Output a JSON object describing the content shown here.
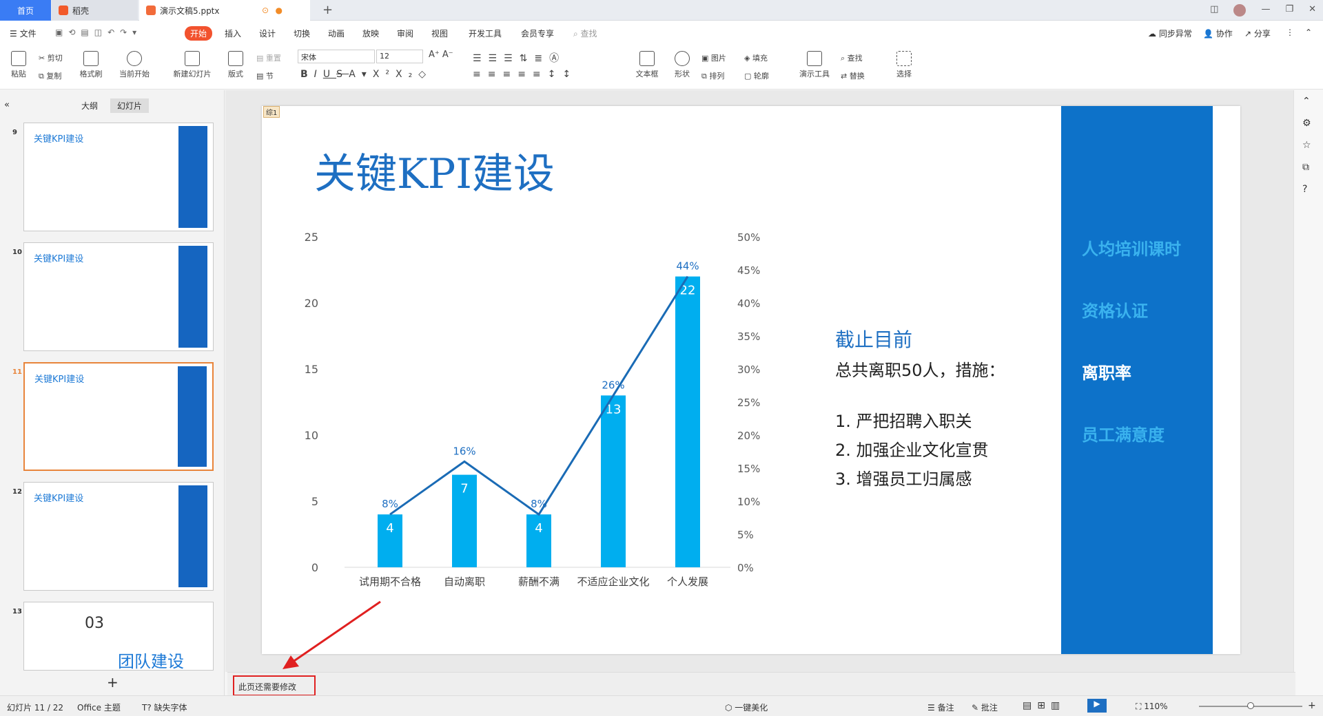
{
  "tabs": {
    "home": "首页",
    "doc1": "稻壳",
    "doc2": "演示文稿5.pptx"
  },
  "menu": {
    "file": "文件",
    "start": "开始",
    "insert": "插入",
    "design": "设计",
    "switch": "切换",
    "animation": "动画",
    "slideshow": "放映",
    "review": "审阅",
    "view": "视图",
    "devtools": "开发工具",
    "member": "会员专享",
    "search": "查找",
    "sync": "同步异常",
    "collab": "协作",
    "share": "分享"
  },
  "toolbar": {
    "paste": "粘贴",
    "cut": "剪切",
    "copy": "复制",
    "format_painter": "格式刷",
    "start_slide": "当前开始",
    "new_slide": "新建幻灯片",
    "layout": "版式",
    "reset": "重置",
    "section": "节",
    "font": "宋体",
    "size": "12",
    "textbox": "文本框",
    "shape": "形状",
    "picture": "图片",
    "arrange": "排列",
    "fill": "填充",
    "outline": "轮廓",
    "present_tools": "演示工具",
    "find": "查找",
    "replace": "替换",
    "select": "选择"
  },
  "panel": {
    "outline_tab": "大纲",
    "slides_tab": "幻灯片",
    "add": "+"
  },
  "thumbs": [
    {
      "num": "9",
      "title": "关键KPI建设"
    },
    {
      "num": "10",
      "title": "关键KPI建设"
    },
    {
      "num": "11",
      "title": "关键KPI建设"
    },
    {
      "num": "12",
      "title": "关键KPI建设"
    },
    {
      "num": "13",
      "title": "团队建设",
      "sub": "03"
    }
  ],
  "slide": {
    "tag": "综1",
    "title": "关键KPI建设",
    "side_items": [
      "人均培训课时",
      "资格认证",
      "离职率",
      "员工满意度"
    ],
    "text_head": "截止目前",
    "text_sub": "总共离职50人，措施：",
    "measures": [
      "1. 严把招聘入职关",
      "2. 加强企业文化宣贯",
      "3. 增强员工归属感"
    ]
  },
  "chart_data": {
    "type": "bar",
    "categories": [
      "试用期不合格",
      "自动离职",
      "薪酬不满",
      "不适应企业文化",
      "个人发展"
    ],
    "series": [
      {
        "values": [
          4,
          7,
          4,
          13,
          22
        ],
        "color": "#00aeef"
      },
      {
        "values": [
          8,
          16,
          8,
          26,
          44
        ],
        "color": "#1a6bb5",
        "type": "line",
        "unit": "%"
      }
    ],
    "ylim": [
      0,
      25
    ],
    "yticks": [
      0,
      5,
      10,
      15,
      20,
      25
    ],
    "y2lim": [
      0,
      50
    ],
    "y2ticks": [
      "0%",
      "5%",
      "10%",
      "15%",
      "20%",
      "25%",
      "30%",
      "35%",
      "40%",
      "45%",
      "50%"
    ],
    "point_labels": [
      "8%",
      "16%",
      "8%",
      "26%",
      "44%"
    ]
  },
  "notes": "此页还需要修改",
  "status": {
    "slide": "幻灯片 11 / 22",
    "theme": "Office 主题",
    "font_missing": "缺失字体",
    "beautify": "一键美化",
    "remark": "备注",
    "comment": "批注",
    "zoom": "110%"
  }
}
